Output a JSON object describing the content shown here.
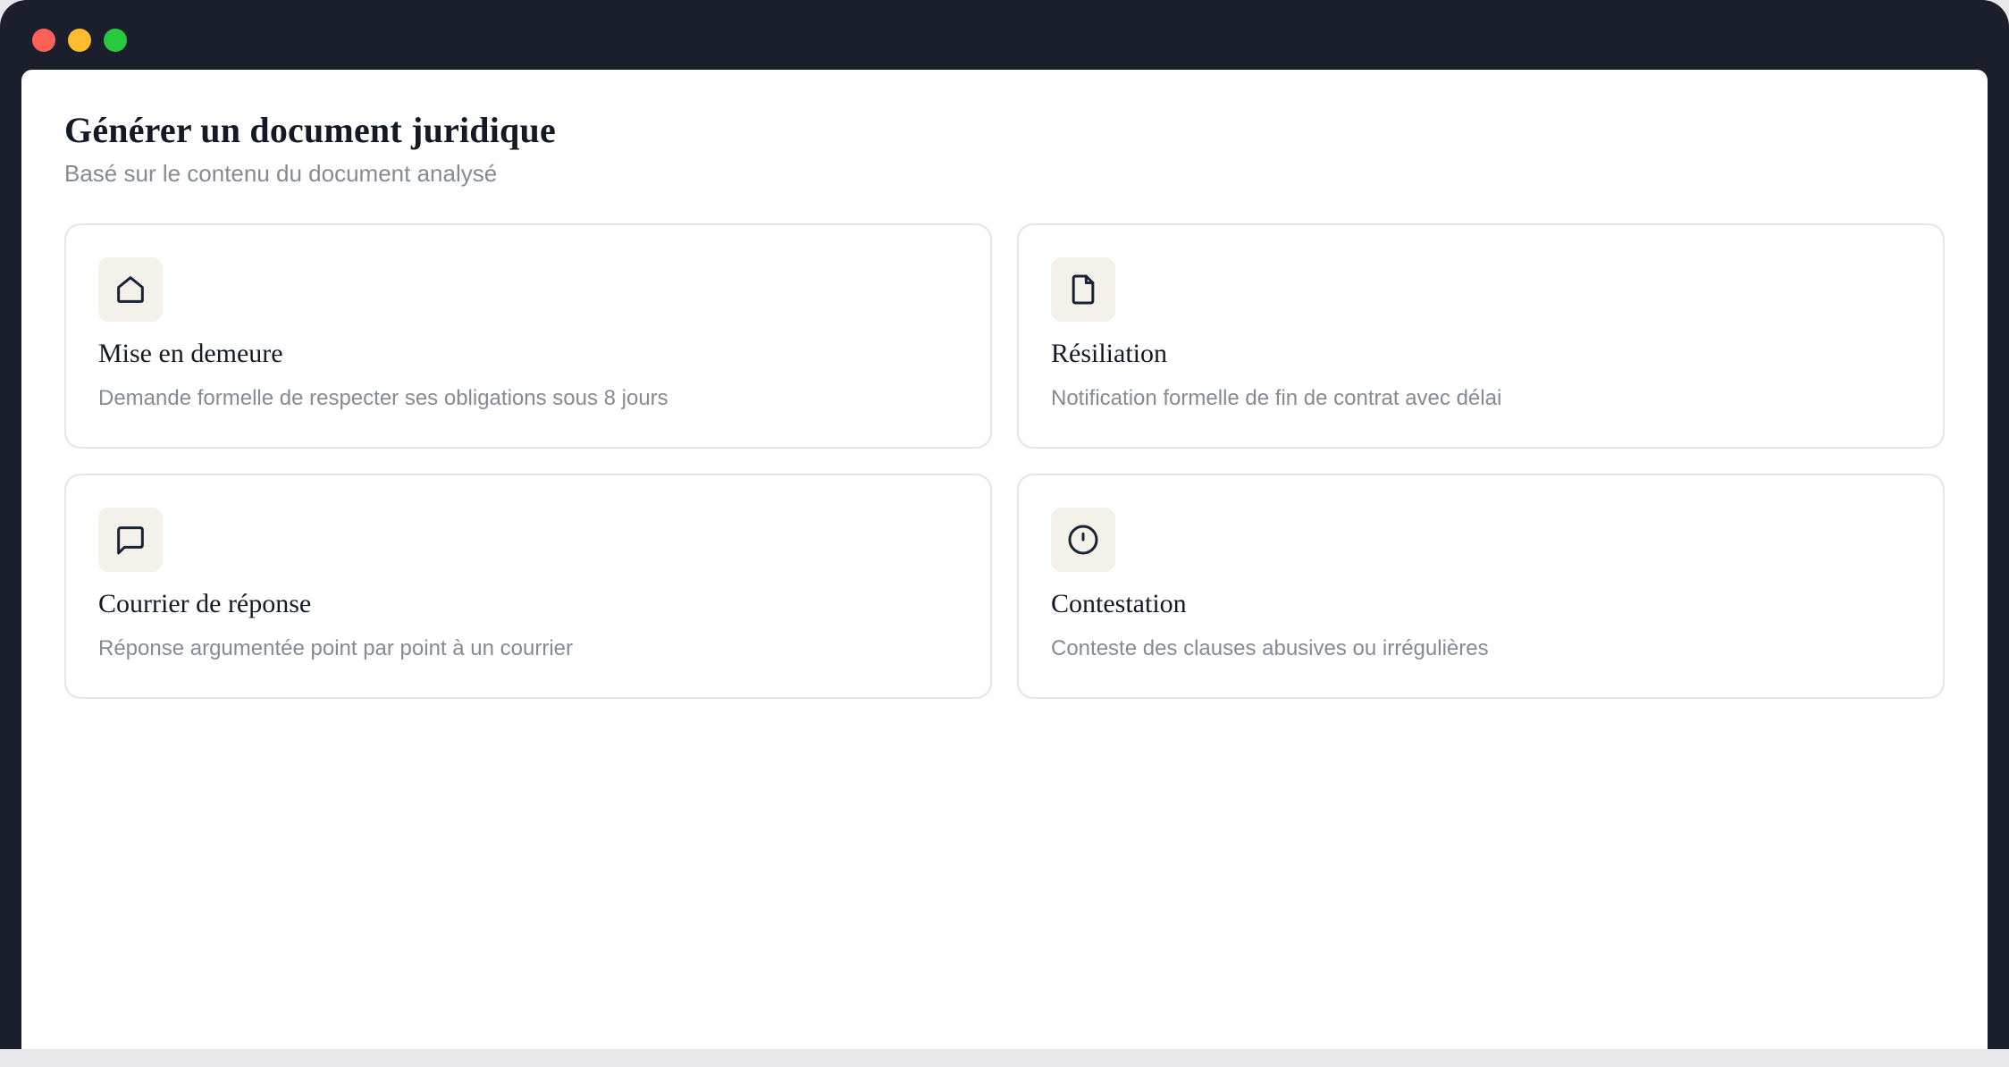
{
  "window": {
    "controls": [
      "close",
      "minimize",
      "maximize"
    ]
  },
  "page": {
    "title": "Générer un document juridique",
    "subtitle": "Basé sur le contenu du document analysé"
  },
  "cards": [
    {
      "icon": "home-icon",
      "title": "Mise en demeure",
      "description": "Demande formelle de respecter ses obligations sous 8 jours"
    },
    {
      "icon": "file-icon",
      "title": "Résiliation",
      "description": "Notification formelle de fin de contrat avec délai"
    },
    {
      "icon": "message-icon",
      "title": "Courrier de réponse",
      "description": "Réponse argumentée point par point à un courrier"
    },
    {
      "icon": "alert-circle-icon",
      "title": "Contestation",
      "description": "Conteste des clauses abusives ou irrégulières"
    }
  ],
  "colors": {
    "window_frame": "#1b1e2b",
    "close": "#fe5f57",
    "minimize": "#febc2e",
    "maximize": "#28c840",
    "icon_bg": "#f4f1ea",
    "icon_stroke": "#1a2336",
    "muted_text": "#858a95"
  }
}
